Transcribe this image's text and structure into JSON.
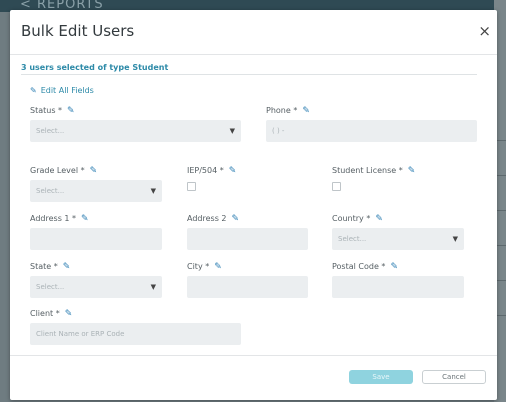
{
  "background": {
    "topbar_text": "< REPORTS"
  },
  "modal": {
    "title": "Bulk Edit Users",
    "close_symbol": "×",
    "selected_info": "3 users selected of type Student",
    "edit_all_label": "Edit All Fields",
    "fields": {
      "status": {
        "label": "Status *",
        "placeholder": "Select..."
      },
      "phone": {
        "label": "Phone *",
        "placeholder": "( ) -"
      },
      "grade_level": {
        "label": "Grade Level *",
        "placeholder": "Select..."
      },
      "iep": {
        "label": "IEP/504 *"
      },
      "student_license": {
        "label": "Student License *"
      },
      "address1": {
        "label": "Address 1 *"
      },
      "address2": {
        "label": "Address 2"
      },
      "country": {
        "label": "Country *",
        "placeholder": "Select..."
      },
      "state": {
        "label": "State *",
        "placeholder": "Select..."
      },
      "city": {
        "label": "City *"
      },
      "postal_code": {
        "label": "Postal Code *"
      },
      "client": {
        "label": "Client *",
        "placeholder": "Client Name or ERP Code"
      }
    },
    "buttons": {
      "save": "Save",
      "cancel": "Cancel"
    }
  },
  "icons": {
    "edit": "pencil-icon",
    "close": "close-icon",
    "dropdown": "caret-down-icon"
  },
  "colors": {
    "accent": "#2d8aa8",
    "save_button": "#8fd3df",
    "input_bg": "#ebeef0"
  }
}
